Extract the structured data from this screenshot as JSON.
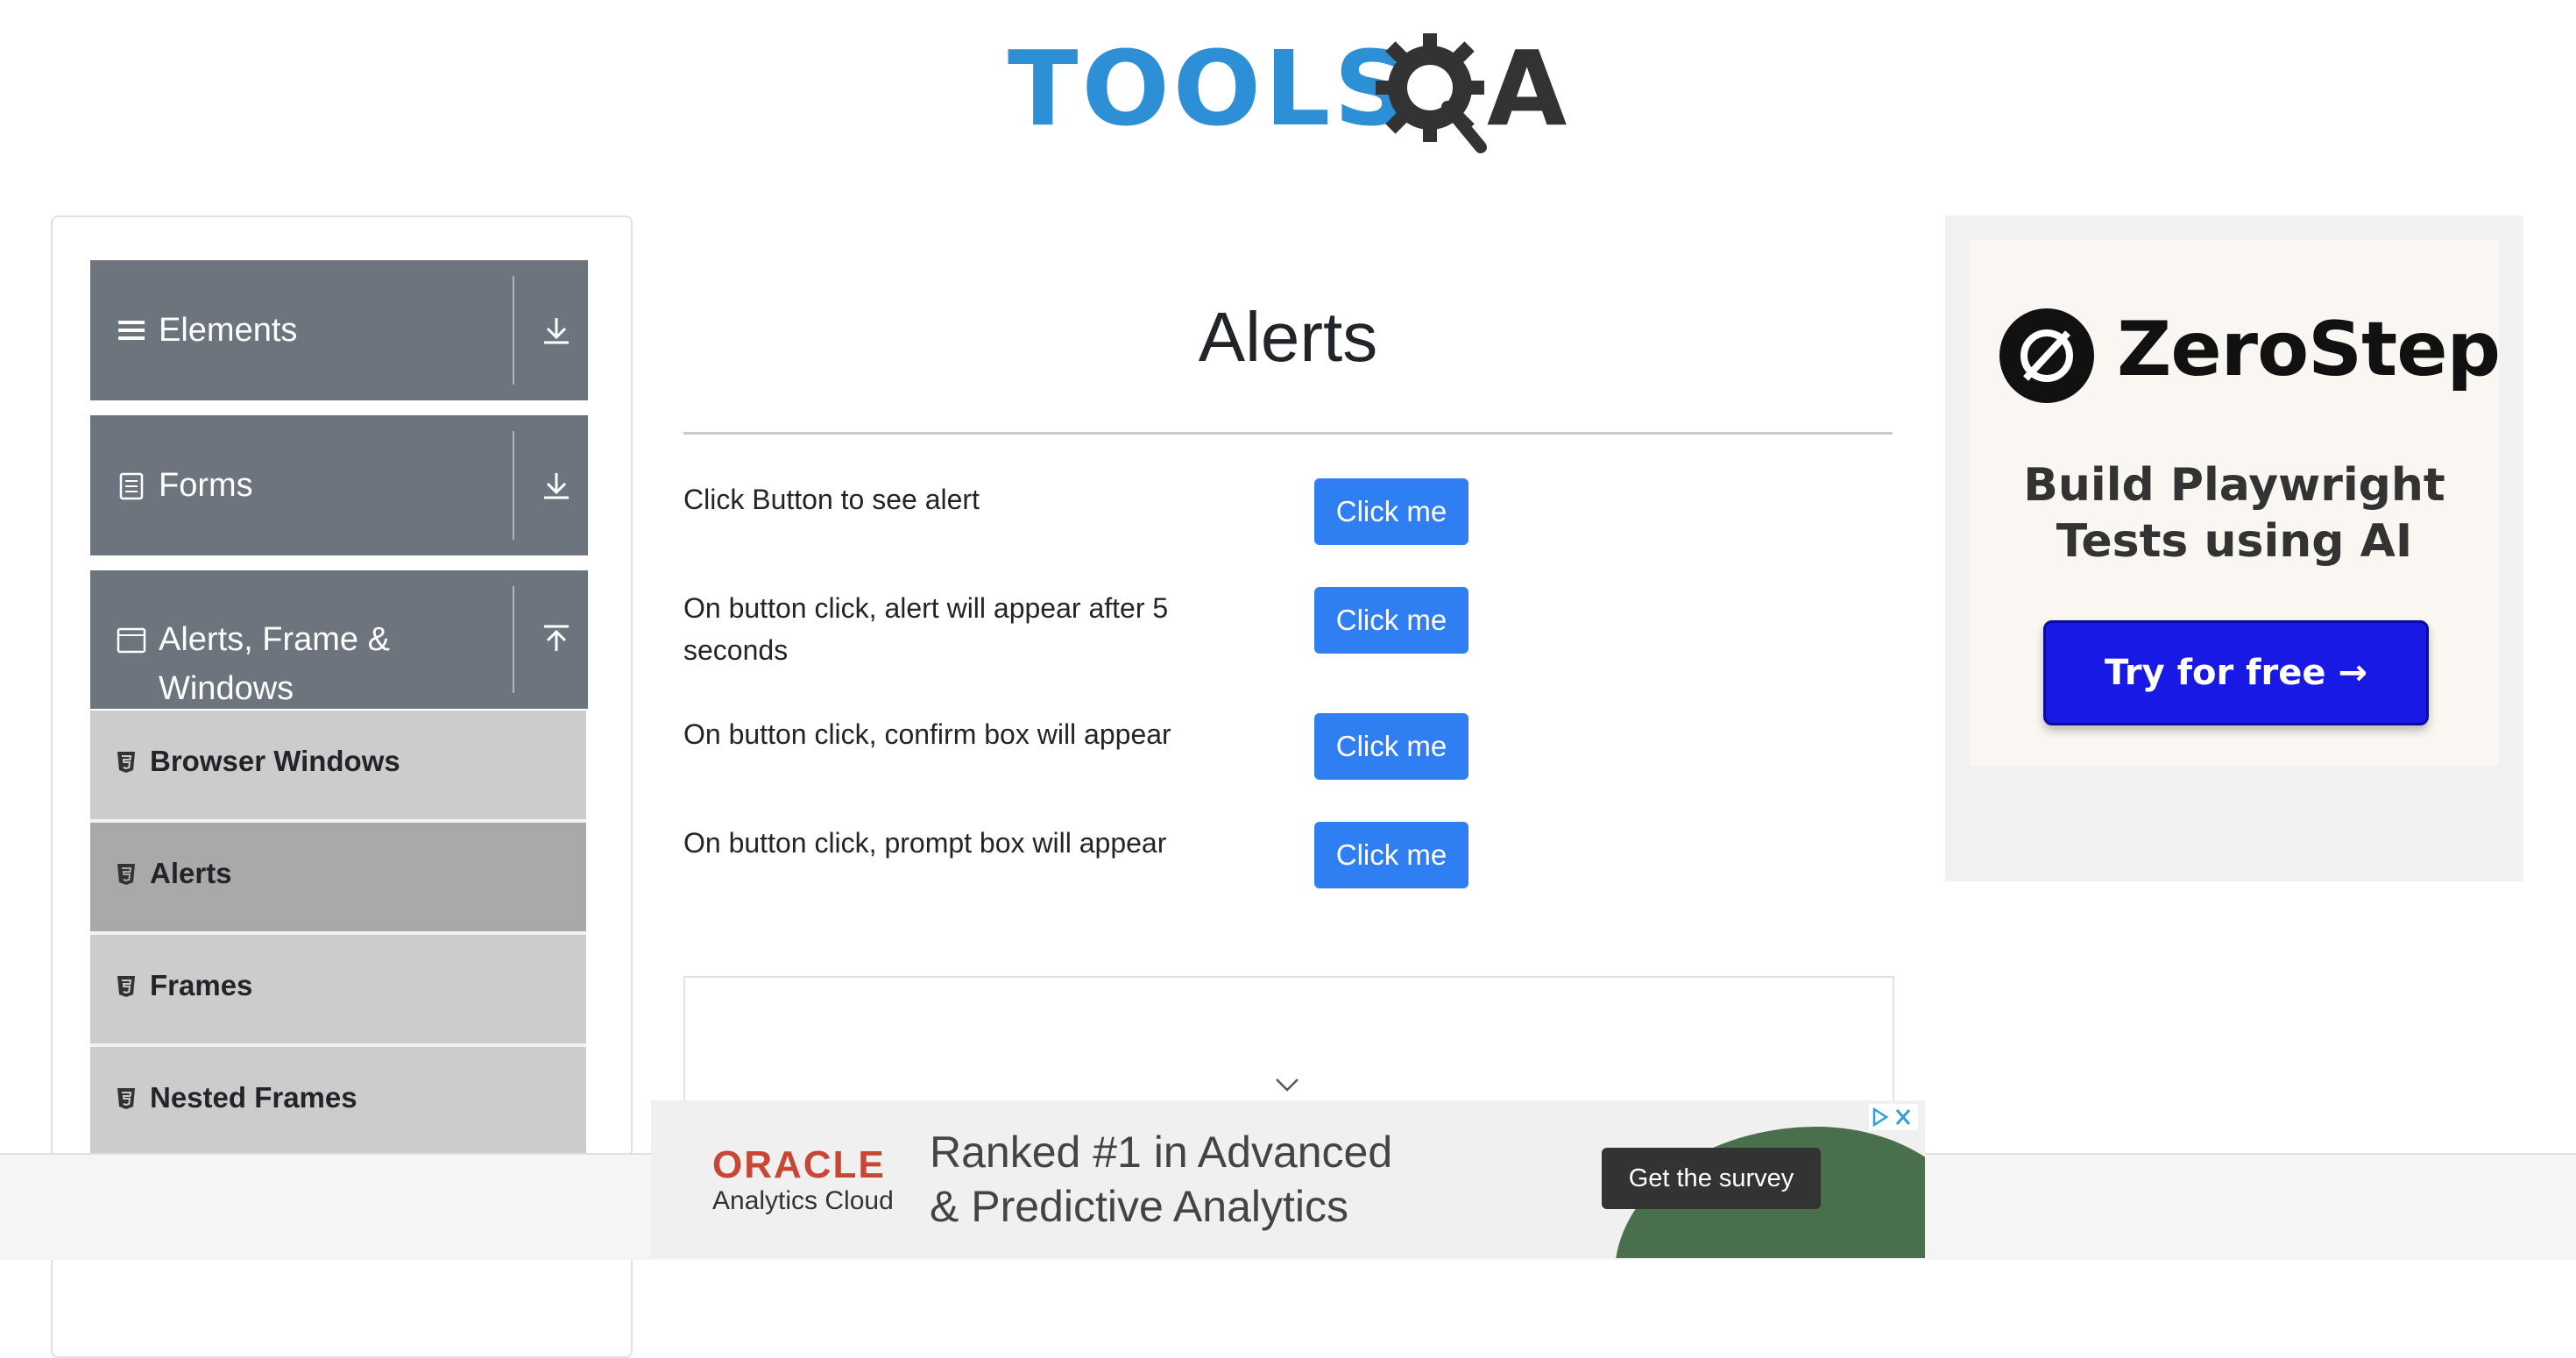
{
  "header": {
    "logo_text_primary": "TOOLS",
    "logo_text_secondary": "A",
    "logo_alt": "TOOLSQA"
  },
  "sidebar": {
    "groups": [
      {
        "label": "Elements",
        "icon": "hamburger-icon",
        "state": "collapsed"
      },
      {
        "label": "Forms",
        "icon": "document-icon",
        "state": "collapsed"
      },
      {
        "label": "Alerts, Frame &",
        "label_line2": "Windows",
        "icon": "window-icon",
        "state": "expanded"
      }
    ],
    "items": [
      {
        "label": "Browser Windows",
        "icon": "html5-icon",
        "active": false
      },
      {
        "label": "Alerts",
        "icon": "html5-icon",
        "active": true
      },
      {
        "label": "Frames",
        "icon": "html5-icon",
        "active": false
      },
      {
        "label": "Nested Frames",
        "icon": "html5-icon",
        "active": false
      }
    ]
  },
  "main": {
    "title": "Alerts",
    "rows": [
      {
        "label": "Click Button to see alert",
        "button": "Click me"
      },
      {
        "label": "On button click, alert will appear after 5 seconds",
        "button": "Click me"
      },
      {
        "label": "On button click, confirm box will appear",
        "button": "Click me"
      },
      {
        "label": "On button click, prompt box will appear",
        "button": "Click me"
      }
    ]
  },
  "ad_right": {
    "brand": "ZeroStep",
    "headline_line1": "Build Playwright",
    "headline_line2": "Tests using AI",
    "cta": "Try for free →"
  },
  "ad_bottom": {
    "brand": "ORACLE",
    "brand_sub": "Analytics Cloud",
    "headline_line1": "Ranked #1 in Advanced",
    "headline_line2": "& Predictive Analytics",
    "cta": "Get the survey"
  },
  "colors": {
    "primary_button": "#2f7ef2",
    "sidebar_group": "#6c757d",
    "sidebar_item": "#cccccc",
    "sidebar_item_active": "#a9a9a9",
    "logo_blue": "#2d8fd6",
    "zerostep_cta": "#1919e6",
    "oracle_red": "#c74634"
  }
}
